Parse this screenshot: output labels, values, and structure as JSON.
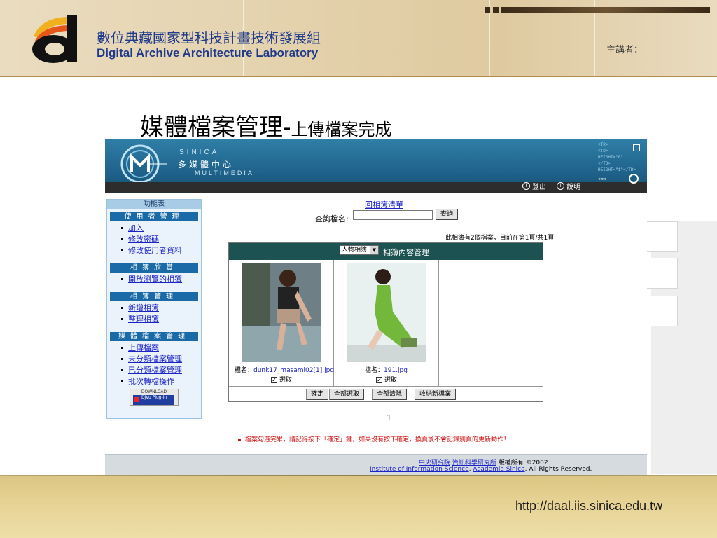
{
  "slide": {
    "org_zh": "數位典藏國家型科技計畫技術發展組",
    "org_en": "Digital Archive Architecture Laboratory",
    "speaker": "主講者：",
    "title_main": "媒體檔案管理-",
    "title_sub": "上傳檔案完成",
    "url": "http://daal.iis.sinica.edu.tw"
  },
  "banner": {
    "sinica": "SINICA",
    "name_zh": "多媒體中心",
    "name_en": "MULTIMEDIA",
    "logout": "登出",
    "help": "說明"
  },
  "sidebar": {
    "title": "功能表",
    "sections": [
      {
        "label": "使用者管理",
        "items": [
          "加入",
          "修改密碼",
          "修改使用者資料"
        ]
      },
      {
        "label": "相簿欣賞",
        "items": [
          "開放瀏覽的相簿"
        ]
      },
      {
        "label": "相簿管理",
        "items": [
          "新增相簿",
          "整理相簿"
        ]
      },
      {
        "label": "媒體檔案管理",
        "items": [
          "上傳檔案",
          "未分類檔案管理",
          "已分類檔案管理",
          "批次轉檔操作"
        ]
      }
    ],
    "plugin_top": "DOWNLOAD",
    "plugin_name": "DjVu Plug-in"
  },
  "main": {
    "back_link": "回相簿清單",
    "search_label": "查詢檔名:",
    "search_value": "",
    "search_button": "查詢",
    "count_info": "此相簿有2個檔案，目前在第1頁/共1頁",
    "album_select": "人物相簿",
    "panel_title": "相簿內容管理",
    "files": [
      {
        "label": "檔名：",
        "name": "dunk17_masami02[1].jpg",
        "checked": true,
        "check_label": "選取"
      },
      {
        "label": "檔名：",
        "name": "191.jpg",
        "checked": true,
        "check_label": "選取"
      }
    ],
    "buttons": {
      "confirm": "確定",
      "select_all": "全部選取",
      "clear_all": "全部清除",
      "new_file": "收納新檔案"
    },
    "page_number": "1",
    "notice": "檔案勾選完畢，請記得按下「確定」鍵，如果沒有按下確定，換頁後不會記錄別頁的更新動作！"
  },
  "footer": {
    "inst1": "中央研究院",
    "inst2": "資訊科學研究所",
    "copyright": "版權所有 ©2002",
    "inst_en": "Institute of Information Science",
    "sep": ",",
    "sinica_en": "Academia Sinica",
    "rights": ". All Rights Reserved."
  },
  "colors": {
    "brand_blue": "#1f3a8a",
    "banner": "#1d5e86",
    "panel_head": "#1d5252",
    "sidebar_section": "#1a6aa8",
    "notice_red": "#d01010",
    "link_blue": "#1a22c8"
  }
}
